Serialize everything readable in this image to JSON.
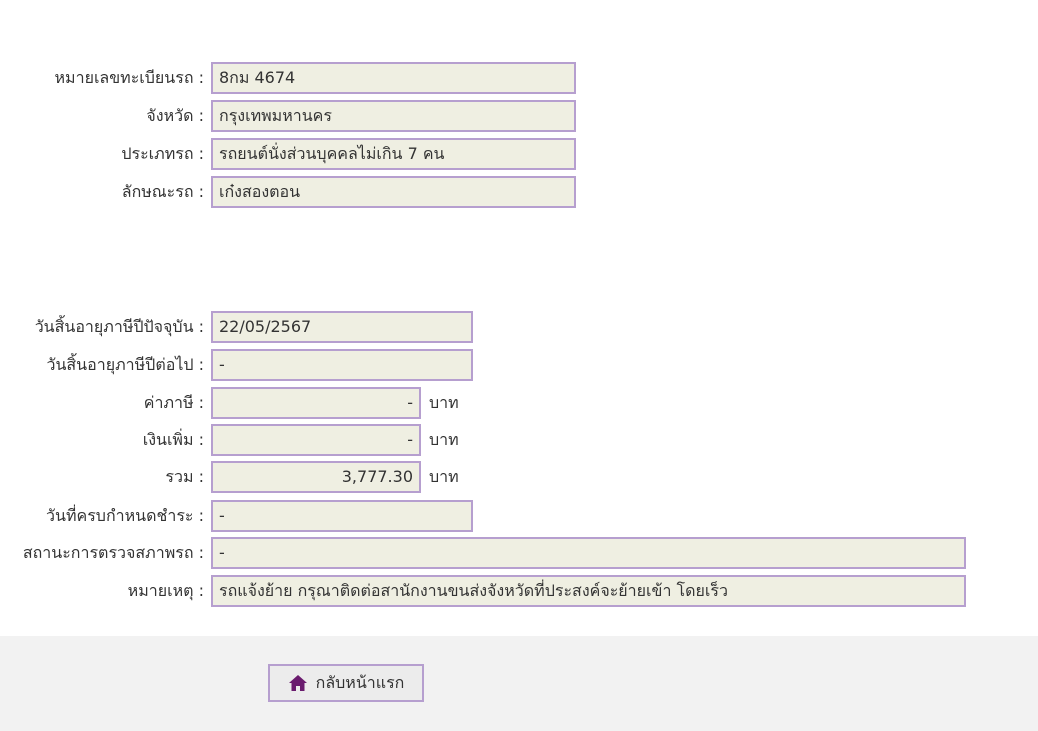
{
  "vehicle": {
    "plate_label": "หมายเลขทะเบียนรถ :",
    "plate_value": "8กม 4674",
    "province_label": "จังหวัด :",
    "province_value": "กรุงเทพมหานคร",
    "type_label": "ประเภทรถ :",
    "type_value": "รถยนต์นั่งส่วนบุคคลไม่เกิน 7 คน",
    "style_label": "ลักษณะรถ :",
    "style_value": "เก๋งสองตอน"
  },
  "tax": {
    "current_expiry_label": "วันสิ้นอายุภาษีปีปัจจุบัน :",
    "current_expiry_value": "22/05/2567",
    "next_expiry_label": "วันสิ้นอายุภาษีปีต่อไป :",
    "next_expiry_value": "-",
    "tax_label": "ค่าภาษี :",
    "tax_value": "-",
    "surcharge_label": "เงินเพิ่ม :",
    "surcharge_value": "-",
    "total_label": "รวม :",
    "total_value": "3,777.30",
    "unit": "บาท",
    "due_date_label": "วันที่ครบกำหนดชำระ :",
    "due_date_value": "-",
    "inspection_label": "สถานะการตรวจสภาพรถ :",
    "inspection_value": "-",
    "remark_label": "หมายเหตุ :",
    "remark_value": "รถแจ้งย้าย กรุณาติดต่อสานักงานขนส่งจังหวัดที่ประสงค์จะย้ายเข้า โดยเร็ว"
  },
  "footer": {
    "home_button_label": "กลับหน้าแรก",
    "home_icon": "home-icon",
    "accent_color": "#6a1b6e"
  }
}
